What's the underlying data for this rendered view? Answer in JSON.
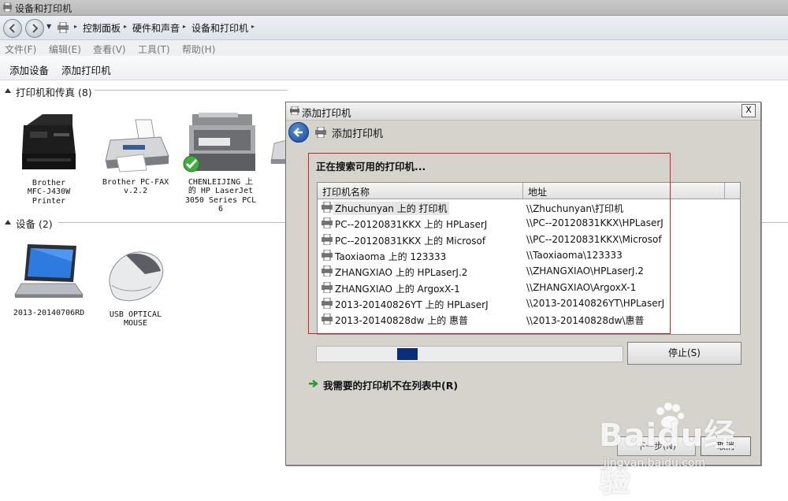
{
  "window": {
    "title": "设备和打印机"
  },
  "breadcrumb": [
    "控制面板",
    "硬件和声音",
    "设备和打印机"
  ],
  "menu": [
    "文件(F)",
    "编辑(E)",
    "查看(V)",
    "工具(T)",
    "帮助(H)"
  ],
  "commands": {
    "add_device": "添加设备",
    "add_printer": "添加打印机"
  },
  "groups": {
    "printers": {
      "label": "打印机和传真 (8)",
      "devices": [
        {
          "name": "Brother MFC-J430W Printer",
          "lines": [
            "Brother",
            "MFC-J430W",
            "Printer"
          ]
        },
        {
          "name": "Brother PC-FAX v.2.2",
          "lines": [
            "Brother PC-FAX",
            "v.2.2"
          ]
        },
        {
          "name": "CHENLEIJING 上的 HP LaserJet 3050 Series PCL 6",
          "lines": [
            "CHENLEIJING 上",
            "的 HP LaserJet",
            "3050 Series PCL",
            "6"
          ]
        }
      ]
    },
    "devices": {
      "label": "设备 (2)",
      "devices": [
        {
          "name": "2013-20140706RD",
          "lines": [
            "2013-20140706RD"
          ]
        },
        {
          "name": "USB OPTICAL MOUSE",
          "lines": [
            "USB OPTICAL",
            "MOUSE"
          ]
        }
      ]
    }
  },
  "dialog": {
    "title": "添加打印机",
    "header": "添加打印机",
    "close_label": "X",
    "search_message": "正在搜索可用的打印机...",
    "columns": {
      "name": "打印机名称",
      "address": "地址"
    },
    "printers": [
      {
        "name": "Zhuchunyan 上的 打印机",
        "address": "\\\\Zhuchunyan\\打印机"
      },
      {
        "name": "PC--20120831KKX 上的 HPLaserJ",
        "address": "\\\\PC--20120831KKX\\HPLaserJ"
      },
      {
        "name": "PC--20120831KKX 上的 Microsof",
        "address": "\\\\PC--20120831KKX\\Microsof"
      },
      {
        "name": "Taoxiaoma 上的 123333",
        "address": "\\\\Taoxiaoma\\123333"
      },
      {
        "name": "ZHANGXIAO 上的 HPLaserJ.2",
        "address": "\\\\ZHANGXIAO\\HPLaserJ.2"
      },
      {
        "name": "ZHANGXIAO 上的 ArgoxX-1",
        "address": "\\\\ZHANGXIAO\\ArgoxX-1"
      },
      {
        "name": "2013-20140826YT 上的 HPLaserJ",
        "address": "\\\\2013-20140826YT\\HPLaserJ"
      },
      {
        "name": "2013-20140828dw 上的 惠普",
        "address": "\\\\2013-20140828dw\\惠普"
      }
    ],
    "progress": 0.3,
    "stop_label": "停止(S)",
    "not_listed": "我需要的打印机不在列表中(R)",
    "next_label": "下一步(N)",
    "cancel_label": "取消"
  },
  "watermark": {
    "text": "Baidu经验",
    "url": "jingyan.baidu.com"
  },
  "colors": {
    "selection_box": "#d32020",
    "progress_fill": "#0a2f78"
  }
}
